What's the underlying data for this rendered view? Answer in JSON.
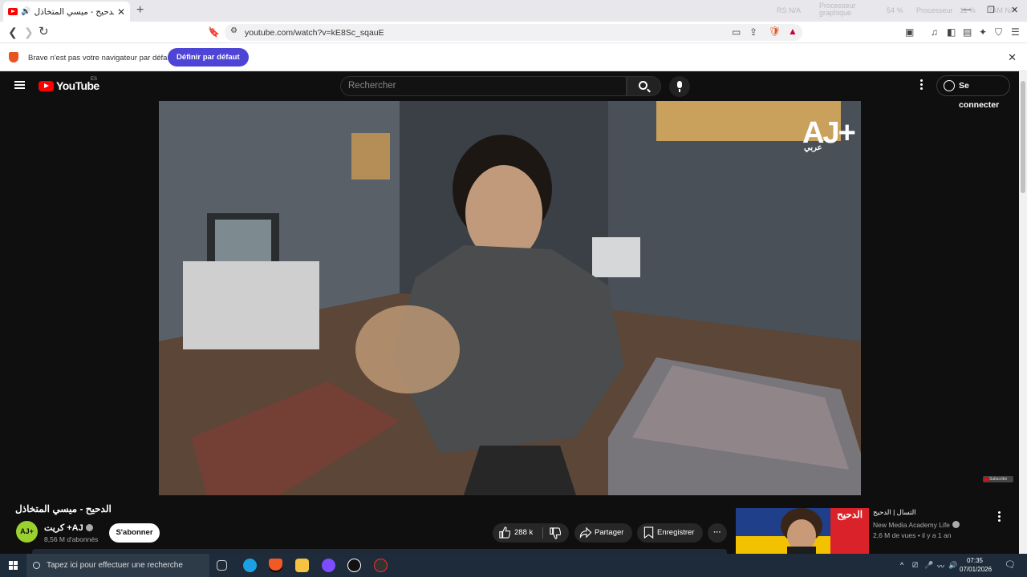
{
  "browser": {
    "tab": {
      "title": "الدحيح - ميسي المتخاذل - YouTube",
      "close": "✕"
    },
    "new_tab": "+",
    "system_overlay": [
      "RS N/A",
      "Processeur graphique",
      "54 %",
      "Processeur",
      "11 %",
      "RAM N/A"
    ],
    "window_controls": [
      "—",
      "❐",
      "✕"
    ],
    "url": "youtube.com/watch?v=kE8Sc_sqauE",
    "nav": {
      "back": "❮",
      "forward": "❯",
      "reload": "↻"
    },
    "infobar": {
      "message": "Brave n'est pas votre navigateur par défaut",
      "button": "Définir par défaut",
      "close": "✕"
    }
  },
  "youtube": {
    "logo_text": "YouTube",
    "region": "ES",
    "search": {
      "placeholder": "Rechercher"
    },
    "signin": "Se connecter",
    "video": {
      "title": "الدحيح - ميسي المتخاذل",
      "watermark": "AJ+",
      "watermark_ar": "عربي",
      "subscribe_overlay": "Subscribe"
    },
    "channel": {
      "name": "كريت +AJ",
      "avatar_text": "AJ+",
      "subscribers": "8,56 M d'abonnés",
      "subscribe": "S'abonner"
    },
    "actions": {
      "likes": "288 k",
      "share": "Partager",
      "save": "Enregistrer"
    },
    "recommendation": {
      "title": "التسال | الدحيح",
      "thumb_text": "الدحيح",
      "channel": "New Media Academy Life",
      "views": "2,6 M de vues",
      "age": "il y a 1 an"
    }
  },
  "taskbar": {
    "search_placeholder": "Tapez ici pour effectuer une recherche",
    "time": "07:35",
    "date": "07/01/2026",
    "tray": [
      "^",
      "⎚",
      "🎤",
      "〰",
      "🔊"
    ],
    "notif": "🗨"
  },
  "colors": {
    "yt_red": "#ff0000",
    "brave_accent": "#4e45d6",
    "background": "#0f0f0f"
  }
}
